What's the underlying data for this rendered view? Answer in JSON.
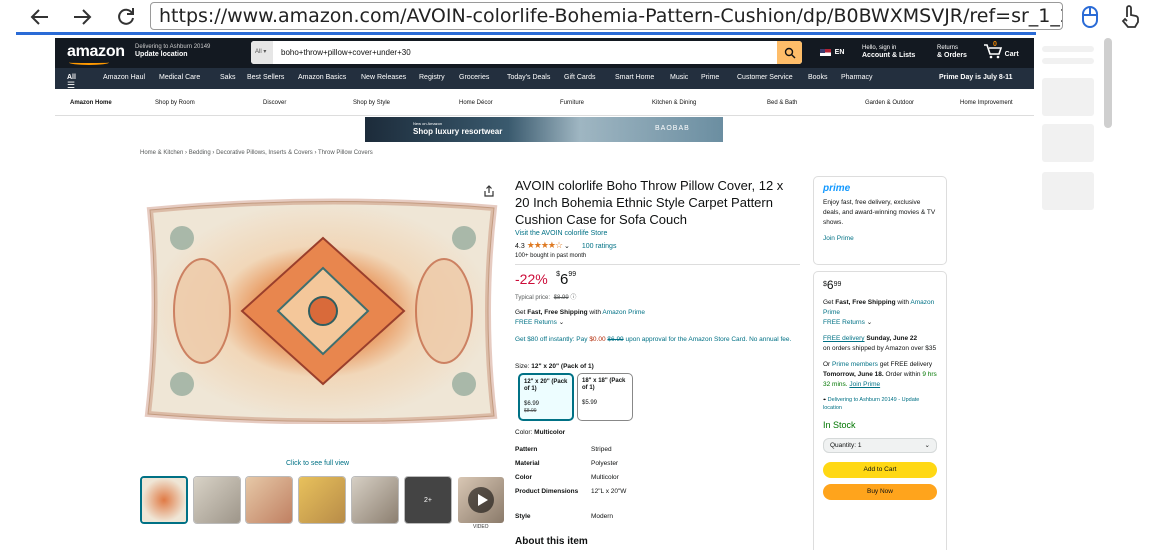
{
  "browser": {
    "url": "https://www.amazon.com/AVOIN-colorlife-Bohemia-Pattern-Cushion/dp/B0BWXMSVJR/ref=sr_1_2?dib=eyJ2Ijc"
  },
  "header": {
    "logo": "amazon",
    "deliver_line1": "Delivering to Ashburn 20149",
    "deliver_line2": "Update location",
    "search_category": "All",
    "search_value": "boho+throw+pillow+cover+under+30",
    "lang": "EN",
    "account_line1": "Hello, sign in",
    "account_line2": "Account & Lists",
    "returns_line1": "Returns",
    "returns_line2": "& Orders",
    "cart_count": "0",
    "cart_label": "Cart"
  },
  "subnav": {
    "items": [
      "All",
      "Amazon Haul",
      "Medical Care",
      "Saks",
      "Best Sellers",
      "Amazon Basics",
      "New Releases",
      "Registry",
      "Groceries",
      "Today's Deals",
      "Gift Cards",
      "Smart Home",
      "Music",
      "Prime",
      "Customer Service",
      "Books",
      "Pharmacy"
    ],
    "promo": "Prime Day is July 8-11"
  },
  "storenav": {
    "items": [
      "Amazon Home",
      "Shop by Room",
      "Discover",
      "Shop by Style",
      "Home Décor",
      "Furniture",
      "Kitchen & Dining",
      "Bed & Bath",
      "Garden & Outdoor",
      "Home Improvement"
    ]
  },
  "banner": {
    "line1": "New on Amazon",
    "line2": "Shop luxury resortwear",
    "brand": "BAOBAB"
  },
  "breadcrumb": [
    "Home & Kitchen",
    "Bedding",
    "Decorative Pillows, Inserts & Covers",
    "Throw Pillow Covers"
  ],
  "gallery": {
    "click_full": "Click to see full view",
    "more_count": "2+",
    "video_label": "VIDEO"
  },
  "product": {
    "title": "AVOIN colorlife Boho Throw Pillow Cover, 12 x 20 Inch Bohemia Ethnic Style Carpet Pattern Cushion Case for Sofa Couch",
    "store_link": "Visit the AVOIN colorlife Store",
    "rating": "4.3",
    "stars": "★★★★☆",
    "rating_count": "100 ratings",
    "bought": "100+ bought in past month",
    "discount": "-22%",
    "price_symbol": "$",
    "price_whole": "6",
    "price_frac": "99",
    "typical_label": "Typical price:",
    "typical_value": "$8.99",
    "ship_text_1": "Get ",
    "ship_bold": "Fast, Free Shipping",
    "ship_text_2": " with ",
    "ship_link": "Amazon Prime",
    "free_returns": "FREE Returns",
    "offer_1": "Get $80 off instantly: Pay ",
    "offer_red": "$0.00",
    "offer_strike": "$6.99",
    "offer_2": " upon approval for the Amazon Store Card. No annual fee.",
    "size_label": "Size:",
    "size_value": "12\" x 20\" (Pack of 1)",
    "sizes": [
      {
        "name": "12\" x 20\" (Pack of 1)",
        "price": "$6.99",
        "old": "$8.99"
      },
      {
        "name": "18\" x 18\" (Pack of 1)",
        "price": "$5.99",
        "old": ""
      }
    ],
    "color_label": "Color:",
    "color_value": "Multicolor",
    "specs": [
      {
        "k": "Pattern",
        "v": "Striped"
      },
      {
        "k": "Material",
        "v": "Polyester"
      },
      {
        "k": "Color",
        "v": "Multicolor"
      },
      {
        "k": "Product Dimensions",
        "v": "12\"L x 20\"W"
      },
      {
        "k": "Style",
        "v": "Modern"
      }
    ],
    "about": "About this item"
  },
  "prime_box": {
    "logo": "prime",
    "text": "Enjoy fast, free delivery, exclusive deals, and award-winning movies & TV shows.",
    "link": "Join Prime"
  },
  "buy_box": {
    "price_whole": "6",
    "price_frac": "99",
    "line1_a": "Get ",
    "line1_b": "Fast, Free Shipping",
    "line1_c": " with ",
    "line1_link": "Amazon Prime",
    "free_returns": "FREE Returns",
    "free_delivery_link": "FREE delivery",
    "free_delivery_date": " Sunday, June 22",
    "free_delivery_rest": "on orders shipped by Amazon over $35",
    "or_text": "Or ",
    "prime_members": "Prime members",
    "get_free": " get FREE delivery ",
    "tomorrow": "Tomorrow, June 18.",
    "order_within": " Order within ",
    "countdown": "9 hrs 32 mins.",
    "join_prime": "Join Prime",
    "location": "Delivering to Ashburn 20149 - Update location",
    "stock": "In Stock",
    "quantity": "Quantity: 1",
    "add_to_cart": "Add to Cart",
    "buy_now": "Buy Now"
  },
  "colors": {
    "nav_dark": "#131921",
    "nav_sub": "#232f3e",
    "search_btn": "#febd69",
    "link": "#007185",
    "discount": "#cc0c39",
    "add_cart": "#ffd814",
    "buy_now": "#ffa41c",
    "in_stock": "#007600"
  }
}
